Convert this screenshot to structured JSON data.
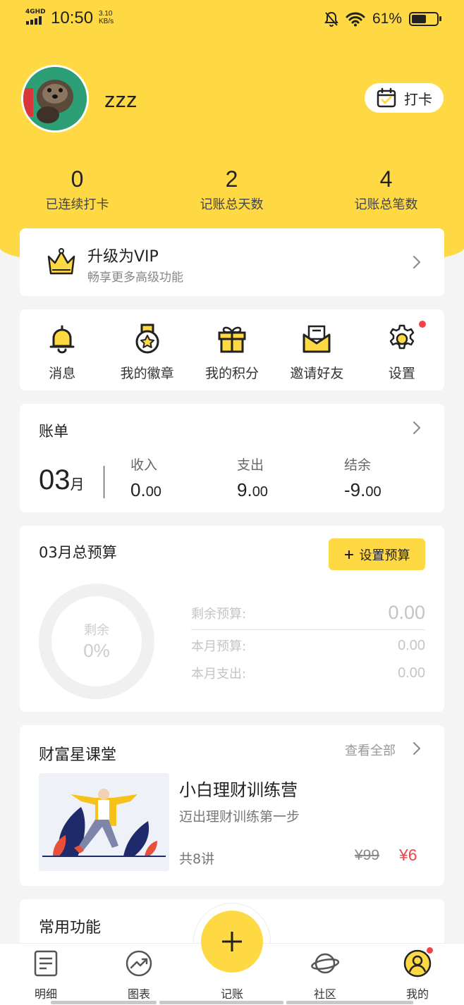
{
  "status_bar": {
    "network": "4GHD",
    "time": "10:50",
    "speed_value": "3.10",
    "speed_unit": "KB/s",
    "battery": "61%",
    "battery_level": 0.61
  },
  "profile": {
    "username": "zzz",
    "checkin_label": "打卡"
  },
  "stats": [
    {
      "value": "0",
      "label": "已连续打卡"
    },
    {
      "value": "2",
      "label": "记账总天数"
    },
    {
      "value": "4",
      "label": "记账总笔数"
    }
  ],
  "vip": {
    "title": "升级为VIP",
    "subtitle": "畅享更多高级功能"
  },
  "menu": [
    {
      "label": "消息",
      "icon": "bell-icon"
    },
    {
      "label": "我的徽章",
      "icon": "medal-icon"
    },
    {
      "label": "我的积分",
      "icon": "gift-icon"
    },
    {
      "label": "邀请好友",
      "icon": "envelope-icon"
    },
    {
      "label": "设置",
      "icon": "gear-icon"
    }
  ],
  "bill": {
    "title": "账单",
    "month": "03",
    "month_unit": "月",
    "income_label": "收入",
    "income_int": "0.",
    "income_dec": "00",
    "expense_label": "支出",
    "expense_int": "9.",
    "expense_dec": "00",
    "balance_label": "结余",
    "balance_int": "-9.",
    "balance_dec": "00"
  },
  "budget": {
    "title": "03月总预算",
    "set_button": "设置预算",
    "ring_label": "剩余",
    "ring_value": "0%",
    "remaining_label": "剩余预算:",
    "remaining_value": "0.00",
    "month_budget_label": "本月预算:",
    "month_budget_value": "0.00",
    "month_expense_label": "本月支出:",
    "month_expense_value": "0.00"
  },
  "classroom": {
    "title": "财富星课堂",
    "view_all": "查看全部",
    "course_title": "小白理财训练营",
    "course_subtitle": "迈出理财训练第一步",
    "lessons": "共8讲",
    "price_old": "¥99",
    "price_new": "¥6"
  },
  "common": {
    "title": "常用功能"
  },
  "tabbar": [
    {
      "label": "明细",
      "icon": "list-icon"
    },
    {
      "label": "图表",
      "icon": "chart-icon"
    },
    {
      "label": "记账",
      "icon": "plus-icon"
    },
    {
      "label": "社区",
      "icon": "planet-icon"
    },
    {
      "label": "我的",
      "icon": "profile-icon"
    }
  ],
  "colors": {
    "brand_yellow": "#fed943",
    "alert_red": "#f2434b"
  }
}
